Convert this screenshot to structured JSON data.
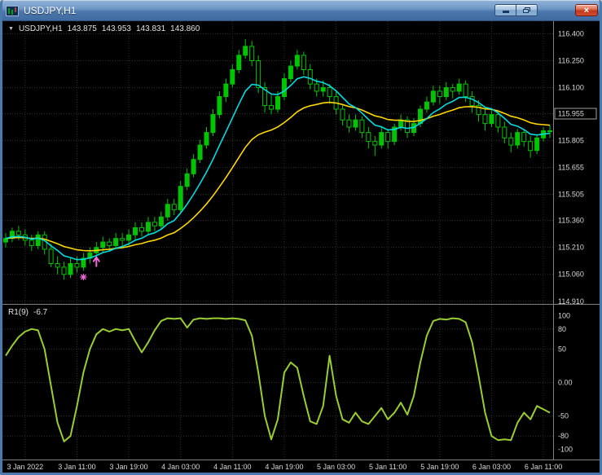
{
  "window": {
    "title": "USDJPY,H1"
  },
  "icons": {
    "dropdown_glyph": "▼",
    "close_glyph": "×"
  },
  "chart": {
    "symbol_period": "USDJPY,H1",
    "ohlc": {
      "open": "143.875",
      "high": "143.953",
      "low": "143.831",
      "close": "143.860"
    },
    "indicator_name": "R1(9)",
    "indicator_value": "-6.7"
  },
  "colors": {
    "chart_background": "#000000",
    "grid": "#2f2f2f",
    "axis_text": "#d8d8d8",
    "separator": "#808080",
    "candle_outline": "#00c400",
    "candle_bull_fill": "#00c400",
    "candle_bear_fill": "#000000",
    "ma_fast": "#00dce0",
    "ma_slow": "#ffd700",
    "oscillator": "#9acd32",
    "annotation": "#f06ad8",
    "current_price_box_border": "#a0a0a0"
  },
  "chart_data": [
    {
      "type": "candlestick",
      "title": "USDJPY,H1",
      "y_range": [
        114.9,
        116.47
      ],
      "price_axis": [
        {
          "label": "116.400",
          "value": 116.4
        },
        {
          "label": "116.250",
          "value": 116.25
        },
        {
          "label": "116.100",
          "value": 116.1
        },
        {
          "label": "115.955",
          "value": 115.955,
          "current": true
        },
        {
          "label": "115.805",
          "value": 115.805
        },
        {
          "label": "115.655",
          "value": 115.655
        },
        {
          "label": "115.505",
          "value": 115.505
        },
        {
          "label": "115.360",
          "value": 115.36
        },
        {
          "label": "115.210",
          "value": 115.21
        },
        {
          "label": "115.060",
          "value": 115.06
        },
        {
          "label": "114.910",
          "value": 114.91
        }
      ],
      "current_price_label": "115.955",
      "x_labels": [
        {
          "label": "3 Jan 2022",
          "index": 3
        },
        {
          "label": "3 Jan 11:00",
          "index": 11
        },
        {
          "label": "3 Jan 19:00",
          "index": 19
        },
        {
          "label": "4 Jan 03:00",
          "index": 27
        },
        {
          "label": "4 Jan 11:00",
          "index": 35
        },
        {
          "label": "4 Jan 19:00",
          "index": 43
        },
        {
          "label": "5 Jan 03:00",
          "index": 51
        },
        {
          "label": "5 Jan 11:00",
          "index": 59
        },
        {
          "label": "5 Jan 19:00",
          "index": 67
        },
        {
          "label": "6 Jan 03:00",
          "index": 75
        },
        {
          "label": "6 Jan 11:00",
          "index": 83
        }
      ],
      "candles": [
        [
          115.24,
          115.29,
          115.21,
          115.26
        ],
        [
          115.26,
          115.32,
          115.24,
          115.3
        ],
        [
          115.3,
          115.33,
          115.25,
          115.28
        ],
        [
          115.28,
          115.31,
          115.22,
          115.25
        ],
        [
          115.25,
          115.28,
          115.19,
          115.22
        ],
        [
          115.22,
          115.3,
          115.2,
          115.28
        ],
        [
          115.28,
          115.3,
          115.17,
          115.2
        ],
        [
          115.2,
          115.23,
          115.1,
          115.12
        ],
        [
          115.12,
          115.16,
          115.06,
          115.1
        ],
        [
          115.1,
          115.13,
          115.03,
          115.06
        ],
        [
          115.06,
          115.15,
          115.04,
          115.12
        ],
        [
          115.12,
          115.16,
          115.07,
          115.1
        ],
        [
          115.1,
          115.18,
          115.08,
          115.15
        ],
        [
          115.15,
          115.21,
          115.12,
          115.18
        ],
        [
          115.18,
          115.24,
          115.15,
          115.21
        ],
        [
          115.21,
          115.27,
          115.18,
          115.24
        ],
        [
          115.24,
          115.26,
          115.19,
          115.22
        ],
        [
          115.22,
          115.29,
          115.2,
          115.26
        ],
        [
          115.26,
          115.29,
          115.22,
          115.25
        ],
        [
          115.25,
          115.31,
          115.22,
          115.28
        ],
        [
          115.28,
          115.35,
          115.25,
          115.32
        ],
        [
          115.32,
          115.35,
          115.27,
          115.3
        ],
        [
          115.3,
          115.38,
          115.28,
          115.35
        ],
        [
          115.35,
          115.38,
          115.3,
          115.33
        ],
        [
          115.33,
          115.41,
          115.31,
          115.38
        ],
        [
          115.38,
          115.48,
          115.36,
          115.45
        ],
        [
          115.45,
          115.48,
          115.39,
          115.42
        ],
        [
          115.42,
          115.58,
          115.4,
          115.55
        ],
        [
          115.55,
          115.65,
          115.53,
          115.62
        ],
        [
          115.62,
          115.73,
          115.6,
          115.7
        ],
        [
          115.7,
          115.81,
          115.68,
          115.78
        ],
        [
          115.78,
          115.88,
          115.76,
          115.85
        ],
        [
          115.85,
          115.98,
          115.83,
          115.95
        ],
        [
          115.95,
          116.08,
          115.93,
          116.05
        ],
        [
          116.05,
          116.15,
          116.02,
          116.12
        ],
        [
          116.12,
          116.23,
          116.1,
          116.2
        ],
        [
          116.2,
          116.31,
          116.18,
          116.28
        ],
        [
          116.28,
          116.37,
          116.26,
          116.33
        ],
        [
          116.33,
          116.36,
          116.22,
          116.25
        ],
        [
          116.25,
          116.28,
          116.07,
          116.1
        ],
        [
          116.1,
          116.13,
          115.96,
          116.0
        ],
        [
          116.0,
          116.06,
          115.95,
          115.98
        ],
        [
          115.98,
          116.08,
          115.96,
          116.05
        ],
        [
          116.05,
          116.18,
          116.03,
          116.15
        ],
        [
          116.15,
          116.25,
          116.13,
          116.22
        ],
        [
          116.22,
          116.31,
          116.2,
          116.28
        ],
        [
          116.28,
          116.3,
          116.17,
          116.2
        ],
        [
          116.2,
          116.23,
          116.09,
          116.12
        ],
        [
          116.12,
          116.15,
          116.05,
          116.08
        ],
        [
          116.08,
          116.14,
          116.05,
          116.1
        ],
        [
          116.1,
          116.12,
          116.01,
          116.05
        ],
        [
          116.05,
          116.08,
          115.95,
          115.98
        ],
        [
          115.98,
          116.01,
          115.89,
          115.92
        ],
        [
          115.92,
          115.95,
          115.85,
          115.88
        ],
        [
          115.88,
          115.95,
          115.86,
          115.92
        ],
        [
          115.92,
          115.94,
          115.82,
          115.85
        ],
        [
          115.85,
          115.88,
          115.76,
          115.8
        ],
        [
          115.8,
          115.83,
          115.72,
          115.78
        ],
        [
          115.78,
          115.88,
          115.76,
          115.85
        ],
        [
          115.85,
          115.87,
          115.76,
          115.8
        ],
        [
          115.8,
          115.9,
          115.78,
          115.88
        ],
        [
          115.88,
          115.95,
          115.86,
          115.92
        ],
        [
          115.92,
          115.94,
          115.82,
          115.85
        ],
        [
          115.85,
          115.93,
          115.83,
          115.9
        ],
        [
          115.9,
          116.0,
          115.88,
          115.98
        ],
        [
          115.98,
          116.05,
          115.96,
          116.02
        ],
        [
          116.02,
          116.11,
          116.0,
          116.08
        ],
        [
          116.08,
          116.11,
          116.01,
          116.05
        ],
        [
          116.05,
          116.13,
          116.03,
          116.1
        ],
        [
          116.1,
          116.12,
          116.04,
          116.08
        ],
        [
          116.08,
          116.15,
          116.06,
          116.12
        ],
        [
          116.12,
          116.14,
          116.02,
          116.05
        ],
        [
          116.05,
          116.08,
          115.96,
          116.0
        ],
        [
          116.0,
          116.03,
          115.91,
          115.95
        ],
        [
          115.95,
          115.98,
          115.86,
          115.9
        ],
        [
          115.9,
          115.98,
          115.88,
          115.95
        ],
        [
          115.95,
          115.97,
          115.85,
          115.88
        ],
        [
          115.88,
          115.91,
          115.79,
          115.82
        ],
        [
          115.82,
          115.85,
          115.74,
          115.78
        ],
        [
          115.78,
          115.87,
          115.76,
          115.85
        ],
        [
          115.85,
          115.87,
          115.77,
          115.8
        ],
        [
          115.8,
          115.83,
          115.71,
          115.75
        ],
        [
          115.75,
          115.84,
          115.73,
          115.82
        ],
        [
          115.82,
          115.88,
          115.8,
          115.86
        ],
        [
          115.86,
          115.89,
          115.82,
          115.86
        ]
      ],
      "overlays": [
        {
          "name": "ma-fast",
          "type": "ema",
          "period": 8,
          "color_key": "ma_fast"
        },
        {
          "name": "ma-slow",
          "type": "ema",
          "period": 21,
          "color_key": "ma_slow"
        }
      ],
      "annotations": [
        {
          "type": "star",
          "index": 12,
          "price": 115.045
        },
        {
          "type": "arrow-up",
          "index": 14,
          "price": 115.16
        }
      ]
    },
    {
      "type": "line",
      "title": "R1(9)",
      "y_range": [
        -115,
        115
      ],
      "axis_labels": [
        {
          "label": "100",
          "value": 100
        },
        {
          "label": "80",
          "value": 80
        },
        {
          "label": "50",
          "value": 50
        },
        {
          "label": "0.00",
          "value": 0
        },
        {
          "label": "-50",
          "value": -50
        },
        {
          "label": "-80",
          "value": -80
        },
        {
          "label": "-100",
          "value": -100
        }
      ],
      "grid_values": [
        80,
        50,
        0,
        -50,
        -80
      ],
      "values": [
        40,
        55,
        68,
        76,
        80,
        78,
        50,
        -5,
        -60,
        -88,
        -80,
        -35,
        15,
        50,
        72,
        80,
        76,
        80,
        78,
        80,
        62,
        45,
        60,
        78,
        92,
        96,
        95,
        96,
        82,
        94,
        96,
        95,
        96,
        96,
        95,
        96,
        95,
        93,
        70,
        15,
        -50,
        -85,
        -55,
        15,
        30,
        22,
        -20,
        -58,
        -62,
        -35,
        40,
        -20,
        -55,
        -60,
        -45,
        -58,
        -62,
        -50,
        -38,
        -55,
        -45,
        -30,
        -48,
        -20,
        30,
        70,
        92,
        95,
        94,
        96,
        95,
        90,
        60,
        10,
        -45,
        -80,
        -86,
        -85,
        -86,
        -60,
        -45,
        -55,
        -35,
        -40,
        -45
      ]
    }
  ]
}
